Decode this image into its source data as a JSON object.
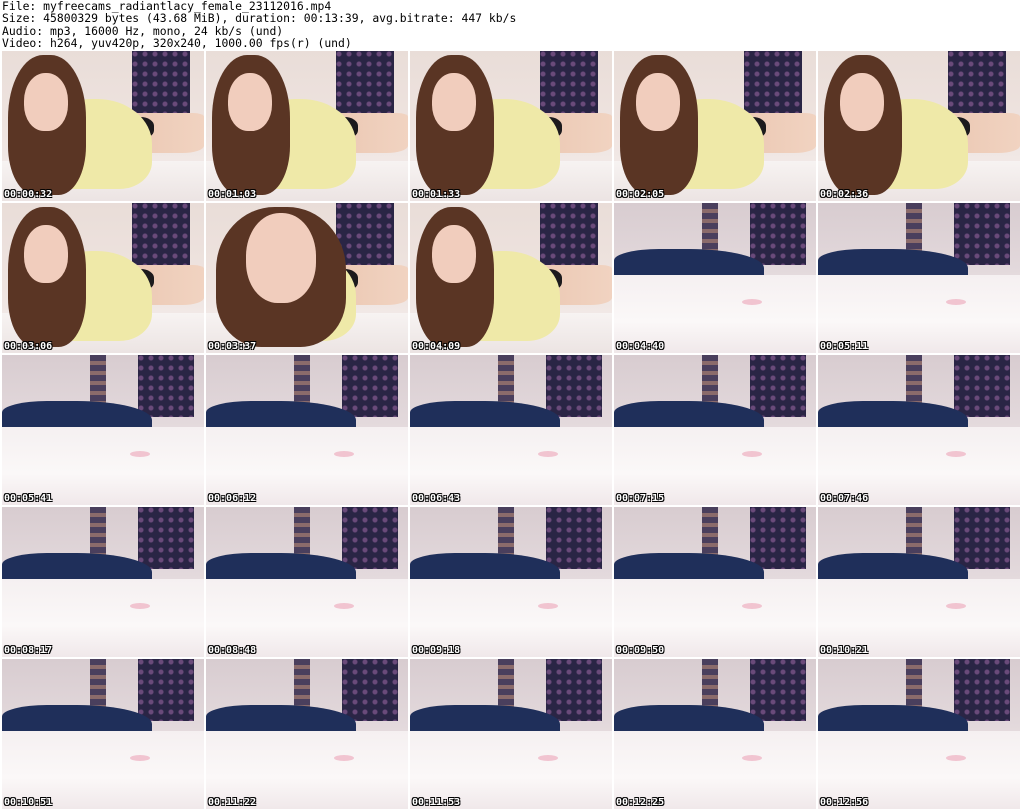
{
  "header": {
    "file": "File: myfreecams_radiantlacy_female_23112016.mp4",
    "size": "Size: 45800329 bytes (43.68 MiB), duration: 00:13:39, avg.bitrate: 447 kb/s",
    "audio": "Audio: mp3, 16000 Hz, mono, 24 kb/s (und)",
    "video": "Video: h264, yuv420p, 320x240, 1000.00 fps(r) (und)"
  },
  "thumbnails": [
    {
      "timestamp": "00:00:32",
      "scene": "person"
    },
    {
      "timestamp": "00:01:03",
      "scene": "person"
    },
    {
      "timestamp": "00:01:33",
      "scene": "person"
    },
    {
      "timestamp": "00:02:05",
      "scene": "person"
    },
    {
      "timestamp": "00:02:36",
      "scene": "person"
    },
    {
      "timestamp": "00:03:06",
      "scene": "person"
    },
    {
      "timestamp": "00:03:37",
      "scene": "person-close"
    },
    {
      "timestamp": "00:04:09",
      "scene": "person"
    },
    {
      "timestamp": "00:04:40",
      "scene": "empty-bed"
    },
    {
      "timestamp": "00:05:11",
      "scene": "empty-bed"
    },
    {
      "timestamp": "00:05:41",
      "scene": "empty-bed"
    },
    {
      "timestamp": "00:06:12",
      "scene": "empty-bed"
    },
    {
      "timestamp": "00:06:43",
      "scene": "empty-bed"
    },
    {
      "timestamp": "00:07:15",
      "scene": "empty-bed"
    },
    {
      "timestamp": "00:07:46",
      "scene": "empty-bed"
    },
    {
      "timestamp": "00:08:17",
      "scene": "empty-bed"
    },
    {
      "timestamp": "00:08:48",
      "scene": "empty-bed"
    },
    {
      "timestamp": "00:09:18",
      "scene": "empty-bed"
    },
    {
      "timestamp": "00:09:50",
      "scene": "empty-bed"
    },
    {
      "timestamp": "00:10:21",
      "scene": "empty-bed"
    },
    {
      "timestamp": "00:10:51",
      "scene": "empty-bed"
    },
    {
      "timestamp": "00:11:22",
      "scene": "empty-bed"
    },
    {
      "timestamp": "00:11:53",
      "scene": "empty-bed"
    },
    {
      "timestamp": "00:12:25",
      "scene": "empty-bed"
    },
    {
      "timestamp": "00:12:56",
      "scene": "empty-bed"
    }
  ]
}
